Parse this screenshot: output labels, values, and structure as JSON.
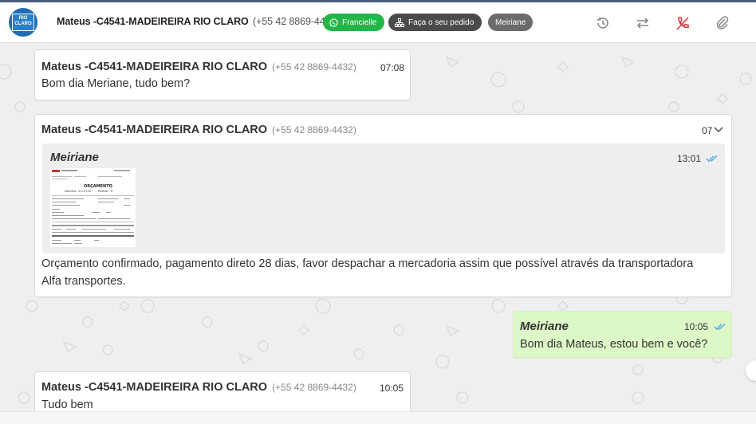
{
  "header": {
    "contact_name": "Mateus -C4541-MADEIREIRA RIO CLARO",
    "contact_phone": "(+55 42 8869-4432)",
    "logo_text": "RIO CLARO",
    "tags": {
      "whatsapp_agent": "Francielle",
      "order": "Faça o seu pedido",
      "assignee": "Meiriane"
    },
    "colors": {
      "whatsapp_pill": "#22b547",
      "order_pill": "#4b4b4b",
      "assignee_pill": "#6b6b6b",
      "hangup_icon": "#d9373a"
    },
    "icons": [
      "history-icon",
      "transfer-icon",
      "hangup-icon",
      "attach-icon"
    ]
  },
  "messages": [
    {
      "sender": "Mateus -C4541-MADEIREIRA RIO CLARO",
      "phone": "(+55 42 8869-4432)",
      "time": "07:08",
      "text": "Bom dia Meriane, tudo bem?"
    },
    {
      "sender": "Mateus -C4541-MADEIREIRA RIO CLARO",
      "phone": "(+55 42 8869-4432)",
      "time": "07",
      "quoted": {
        "author": "Meiriane",
        "time": "13:01",
        "attachment": "ORÇAMENTO",
        "attachment_fields": {
          "numero_label": "Número:",
          "numero": "2.0.5735",
          "pedido_label": "Pedido:",
          "pedido": "0"
        }
      },
      "text": "Orçamento confirmado, pagamento direto 28 dias, favor despachar a mercadoria assim que possível através da transportadora Alfa transportes."
    },
    {
      "sender": "Meiriane",
      "time": "10:05",
      "text": "Bom dia Mateus, estou bem e você?",
      "outgoing": true,
      "status": "read"
    },
    {
      "sender": "Mateus -C4541-MADEIREIRA RIO CLARO",
      "phone": "(+55 42 8869-4432)",
      "time": "10:05",
      "text": "Tudo bem"
    }
  ]
}
